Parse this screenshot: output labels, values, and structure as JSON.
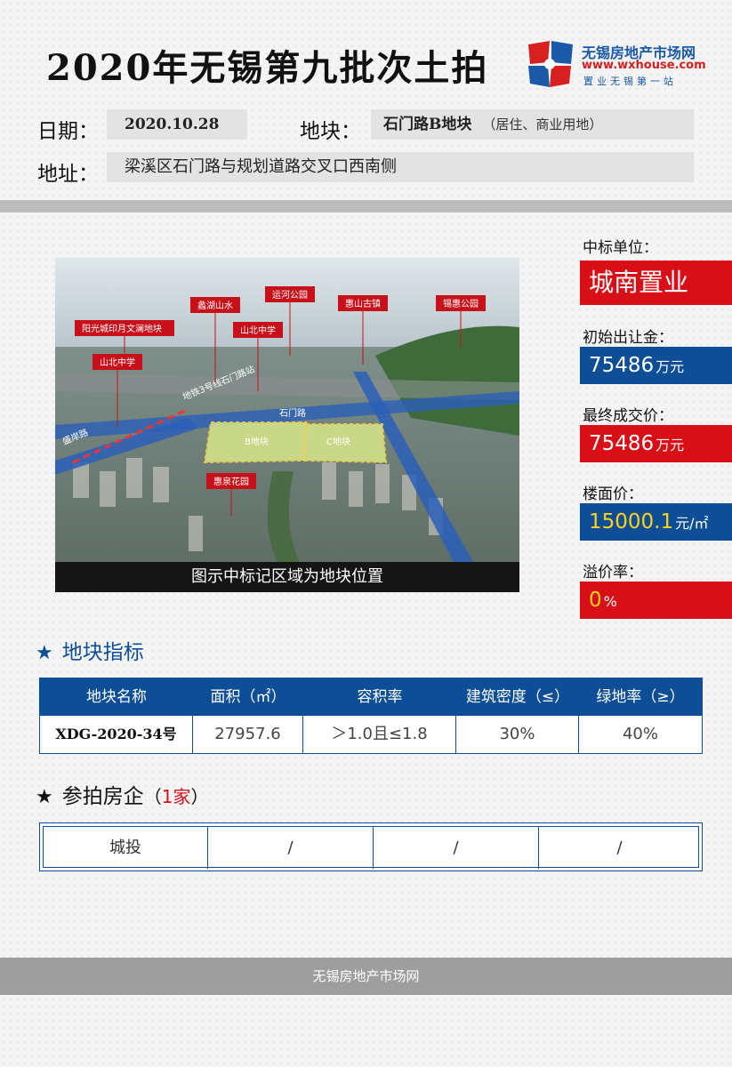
{
  "header": {
    "title": "2020年无锡第九批次土拍",
    "logo": {
      "name": "无锡房地产市场网",
      "url": "www.wxhouse.com",
      "slogan": "置业无锡第一站"
    }
  },
  "info": {
    "date_label": "日期：",
    "date": "2020.10.28",
    "plot_label": "地块：",
    "plot": "石门路B地块",
    "plot_use": "（居住、商业用地）",
    "address_label": "地址：",
    "address": "梁溪区石门路与规划道路交叉口西南侧"
  },
  "image": {
    "labels": [
      "阳光城印月文澜地块",
      "山北中学",
      "蠡湖山水",
      "山北中学",
      "运河公园",
      "惠山古镇",
      "锡惠公园",
      "地铁3号线石门路站",
      "石门路",
      "B地块",
      "C地块",
      "惠泉花园",
      "盛岸路"
    ],
    "caption": "图示中标记区域为地块位置"
  },
  "summary": {
    "winner_label": "中标单位：",
    "winner": "城南置业",
    "start_label": "初始出让金：",
    "start_value": "75486",
    "start_unit": "万元",
    "final_label": "最终成交价：",
    "final_value": "75486",
    "final_unit": "万元",
    "floor_label": "楼面价：",
    "floor_value": "15000.1",
    "floor_unit": "元/㎡",
    "premium_label": "溢价率：",
    "premium_value": "0",
    "premium_unit": "%"
  },
  "indicators": {
    "title": "地块指标",
    "headers": [
      "地块名称",
      "面积（㎡）",
      "容积率",
      "建筑密度（≤）",
      "绿地率（≥）"
    ],
    "row": [
      "XDG-2020-34号",
      "27957.6",
      "＞1.0且≤1.8",
      "30%",
      "40%"
    ]
  },
  "bidders": {
    "title": "参拍房企",
    "count_open": "（",
    "count": "1家",
    "count_close": "）",
    "row": [
      "城投",
      "/",
      "/",
      "/"
    ]
  },
  "footer": {
    "text": "无锡房地产市场网"
  },
  "colors": {
    "blue": "#0d4e96",
    "red": "#d80f16",
    "logo_blue": "#1a5aa8"
  }
}
